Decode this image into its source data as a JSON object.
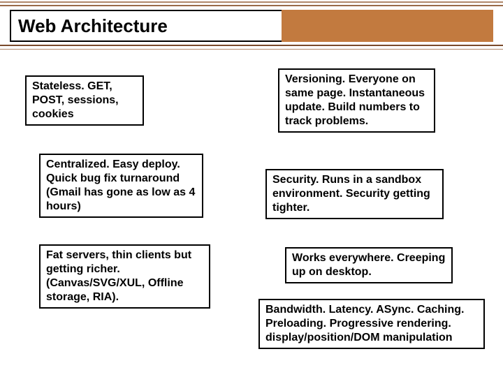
{
  "title": "Web Architecture",
  "boxes": {
    "b1": "Stateless. GET, POST, sessions, cookies",
    "b2": "Centralized. Easy deploy. Quick bug fix turnaround (Gmail has gone as low as 4 hours)",
    "b3": "Fat servers, thin clients but getting richer. (Canvas/SVG/XUL, Offline storage, RIA).",
    "b4": "Versioning. Everyone on same page. Instantaneous update. Build numbers to track problems.",
    "b5": "Security. Runs in a sandbox environment. Security getting tighter.",
    "b6": "Works everywhere. Creeping up on desktop.",
    "b7": "Bandwidth. Latency. ASync. Caching. Preloading. Progressive rendering. display/position/DOM manipulation"
  }
}
